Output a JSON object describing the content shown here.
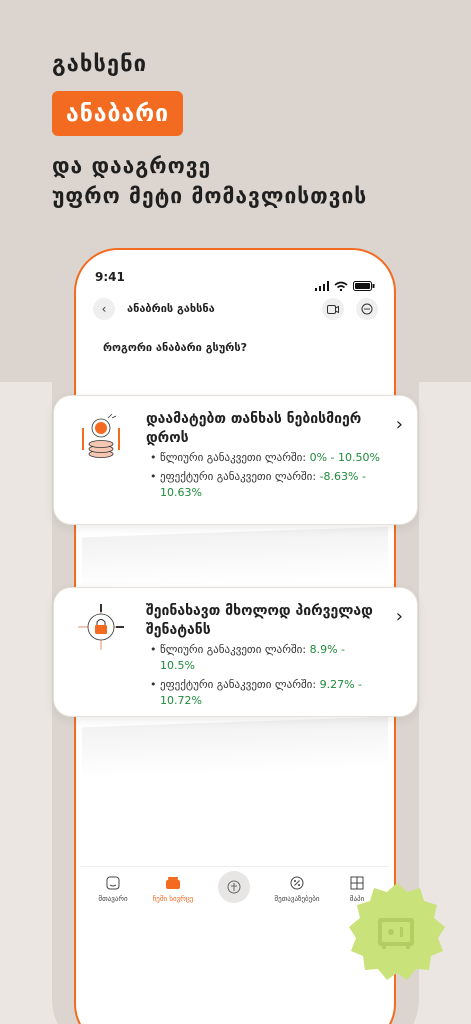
{
  "hero": {
    "line1": "გახსენი",
    "badge": "ანაბარი",
    "line3": "და დააგროვე",
    "line4": "უფრო მეტი მომავლისთვის"
  },
  "status": {
    "time": "9:41"
  },
  "appbar": {
    "title": "ანაბრის გახსნა"
  },
  "question": "როგორი ანაბარი გსურს?",
  "cards": [
    {
      "title": "დაამატებთ თანხას ნებისმიერ დროს",
      "rates": [
        {
          "label": "წლიური განაკვეთი ლარში:",
          "value": "0% - 10.50%"
        },
        {
          "label": "ეფექტური განაკვეთი ლარში:",
          "value": "-8.63% - 10.63%"
        }
      ]
    },
    {
      "title": "შეინახავთ მხოლოდ პირველად შენატანს",
      "rates": [
        {
          "label": "წლიური განაკვეთი ლარში:",
          "value": "8.9% - 10.5%"
        },
        {
          "label": "ეფექტური განაკვეთი ლარში:",
          "value": "9.27% - 10.72%"
        }
      ]
    }
  ],
  "tabs": [
    {
      "label": "მთავარი",
      "icon": "home-icon"
    },
    {
      "label": "ჩემი სივრცე",
      "icon": "wallet-icon",
      "active": true
    },
    {
      "label": "",
      "icon": "payments-icon"
    },
    {
      "label": "შეთავაზებები",
      "icon": "offers-icon"
    },
    {
      "label": "მაპი",
      "icon": "grid-icon"
    }
  ],
  "colors": {
    "accent": "#f26b21",
    "green": "#1f8a3a",
    "seal": "#c9e27a"
  }
}
